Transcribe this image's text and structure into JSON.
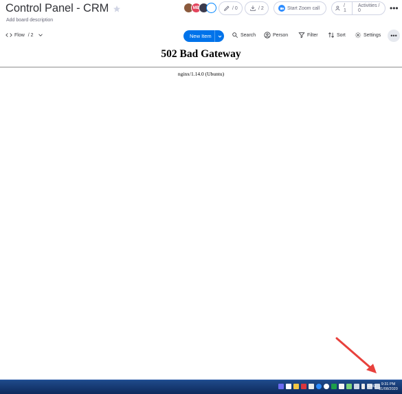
{
  "board": {
    "title": "Control Panel - CRM",
    "description": "Add board description"
  },
  "avatars": [
    "",
    "MB",
    "",
    ""
  ],
  "header_actions": {
    "updates_count": "/ 0",
    "integrations_count": "/ 2",
    "zoom_label": "Start Zoom call",
    "members_count": "/ 1",
    "activities_label": "Activities / 0"
  },
  "toolbar": {
    "view_name": "Flow",
    "view_count": "/ 2",
    "new_item_label": "New Item",
    "search_label": "Search",
    "person_label": "Person",
    "filter_label": "Filter",
    "sort_label": "Sort",
    "settings_label": "Settings"
  },
  "error_page": {
    "title": "502 Bad Gateway",
    "server": "nginx/1.14.0 (Ubuntu)"
  },
  "taskbar": {
    "language": "ENG",
    "time": "9:31 PM",
    "date": "31/08/2020"
  },
  "colors": {
    "accent": "#0073ea",
    "arrow": "#e8413c",
    "taskbar": "#1a3f7a"
  }
}
